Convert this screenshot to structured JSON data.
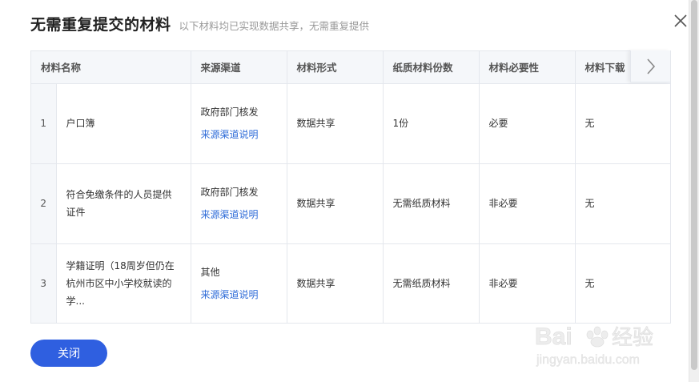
{
  "dialog": {
    "title": "无需重复提交的材料",
    "subtitle": "以下材料均已实现数据共享，无需重复提供"
  },
  "table": {
    "headers": [
      "材料名称",
      "来源渠道",
      "材料形式",
      "纸质材料份数",
      "材料必要性",
      "材料下载"
    ],
    "rows": [
      {
        "index": "1",
        "name": "户口簿",
        "source": "政府部门核发",
        "source_link": "来源渠道说明",
        "form": "数据共享",
        "copies": "1份",
        "necessity": "必要",
        "download": "无"
      },
      {
        "index": "2",
        "name": "符合免缴条件的人员提供证件",
        "source": "政府部门核发",
        "source_link": "来源渠道说明",
        "form": "数据共享",
        "copies": "无需纸质材料",
        "necessity": "非必要",
        "download": "无"
      },
      {
        "index": "3",
        "name": "学籍证明（18周岁但仍在杭州市区中小学校就读的学...",
        "source": "其他",
        "source_link": "来源渠道说明",
        "form": "数据共享",
        "copies": "无需纸质材料",
        "necessity": "非必要",
        "download": "无"
      }
    ]
  },
  "footer": {
    "close_label": "关闭"
  },
  "watermark": {
    "brand": "Bai",
    "brand_cn": "经验",
    "url": "jingyan.baidu.com"
  },
  "icons": {
    "close": "close-icon",
    "next": "chevron-right-icon",
    "paw": "paw-icon"
  },
  "colors": {
    "accent": "#2f5fe0",
    "link": "#2f6cd8"
  }
}
